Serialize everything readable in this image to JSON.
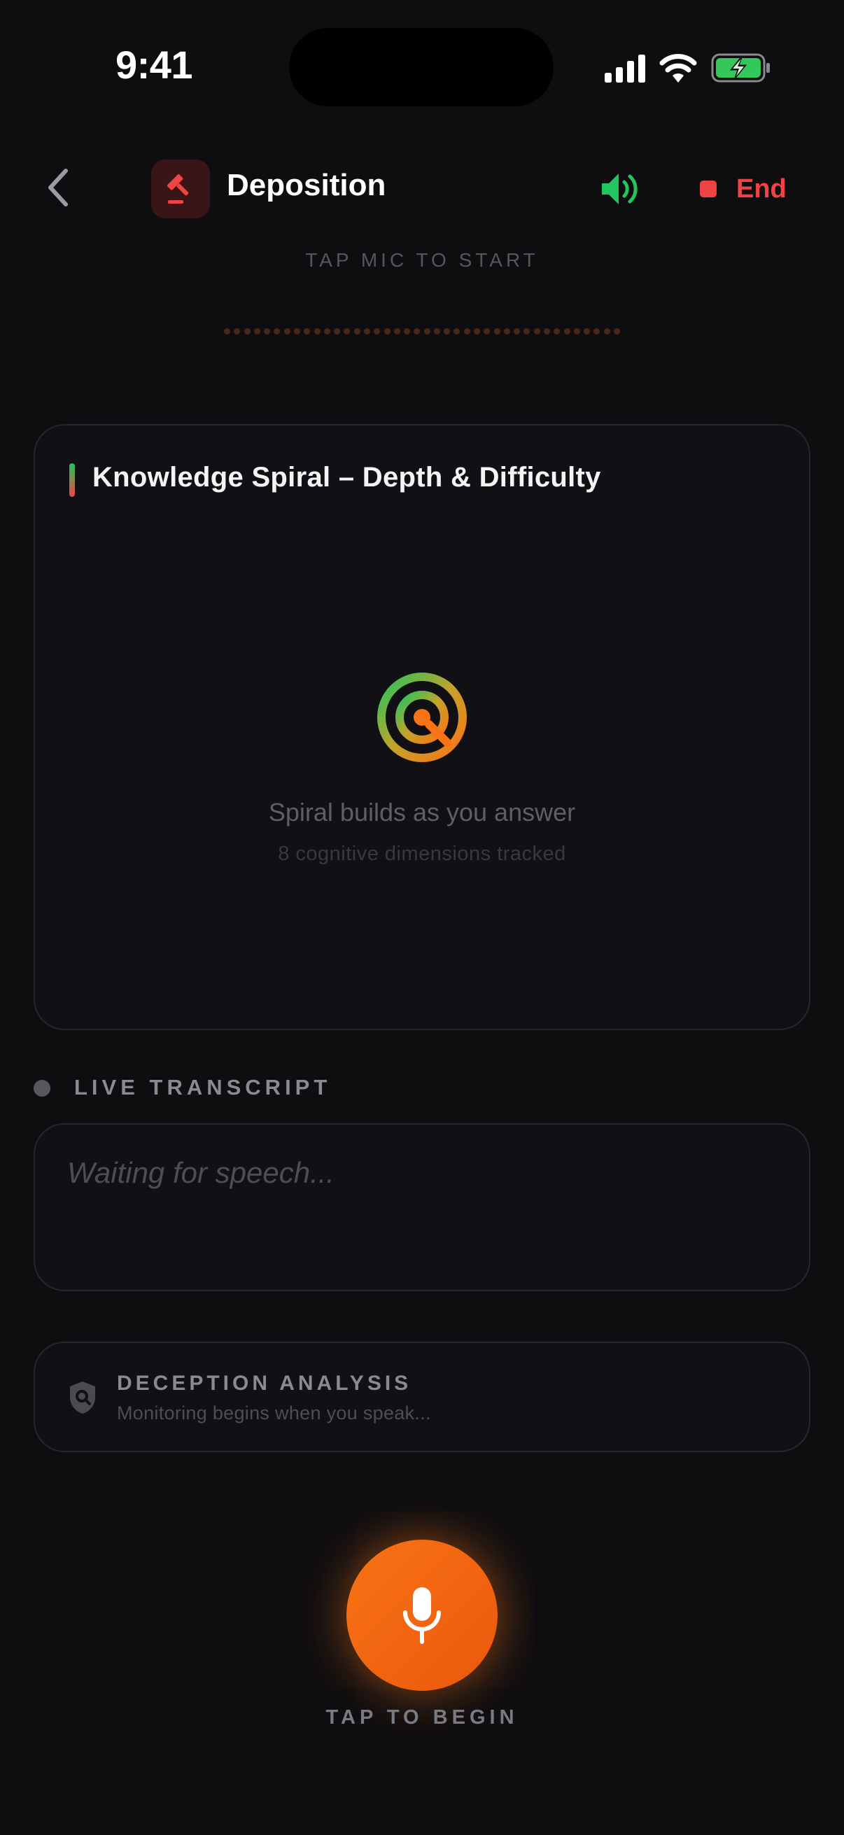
{
  "status_bar": {
    "time": "9:41",
    "icons": [
      "cellular-signal-icon",
      "wifi-icon",
      "battery-charging-icon"
    ]
  },
  "header": {
    "back_icon": "chevron-left-icon",
    "app_icon": "gavel-icon",
    "title": "Deposition",
    "speaker_icon": "speaker-icon",
    "end_label": "End"
  },
  "mic_hint": "TAP MIC TO START",
  "spiral_card": {
    "title": "Knowledge Spiral – Depth & Difficulty",
    "icon": "target-search-icon",
    "message": "Spiral builds as you answer",
    "sub_message": "8 cognitive dimensions tracked"
  },
  "transcript": {
    "label": "LIVE TRANSCRIPT",
    "placeholder": "Waiting for speech..."
  },
  "deception": {
    "icon": "shield-search-icon",
    "title": "DECEPTION ANALYSIS",
    "subtitle": "Monitoring begins when you speak..."
  },
  "mic_button": {
    "icon": "microphone-icon",
    "label": "TAP TO BEGIN"
  },
  "colors": {
    "background": "#0e0e11",
    "accent_orange": "#f97316",
    "end_red": "#ef4444",
    "speaker_green": "#22c55e"
  }
}
